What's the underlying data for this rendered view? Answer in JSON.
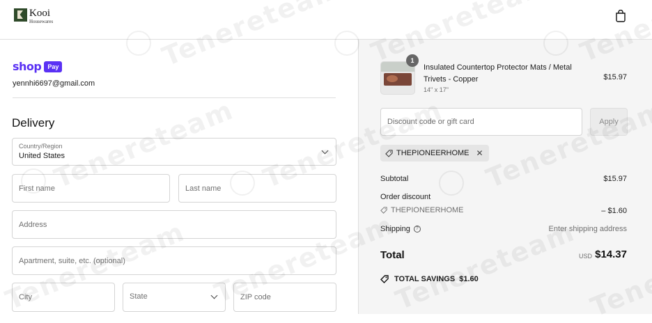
{
  "header": {
    "brand_name": "Kooi",
    "brand_sub": "Housewares",
    "cart_icon": "shopping-bag-icon"
  },
  "contact": {
    "shop_word": "shop",
    "pay_badge": "Pay",
    "email": "yennhi6697@gmail.com"
  },
  "delivery": {
    "heading": "Delivery",
    "country_label": "Country/Region",
    "country_value": "United States",
    "first_name_placeholder": "First name",
    "last_name_placeholder": "Last name",
    "address_placeholder": "Address",
    "apartment_placeholder": "Apartment, suite, etc. (optional)",
    "city_placeholder": "City",
    "state_placeholder": "State",
    "zip_placeholder": "ZIP code"
  },
  "order": {
    "item": {
      "quantity": "1",
      "title": "Insulated Countertop Protector Mats / Metal Trivets - Copper",
      "variant": "14\" x 17\"",
      "price": "$15.97"
    },
    "discount_placeholder": "Discount code or gift card",
    "apply_label": "Apply",
    "applied_code": "THEPIONEERHOME",
    "subtotal_label": "Subtotal",
    "subtotal_value": "$15.97",
    "order_discount_label": "Order discount",
    "discount_code": "THEPIONEERHOME",
    "discount_value": "– $1.60",
    "shipping_label": "Shipping",
    "shipping_value": "Enter shipping address",
    "total_label": "Total",
    "total_currency": "USD",
    "total_value": "$14.37",
    "savings_label": "TOTAL SAVINGS",
    "savings_value": "$1.60"
  },
  "watermark": "Tenereteam",
  "colors": {
    "shop_purple": "#5a31f4",
    "summary_bg": "#f5f5f5"
  }
}
